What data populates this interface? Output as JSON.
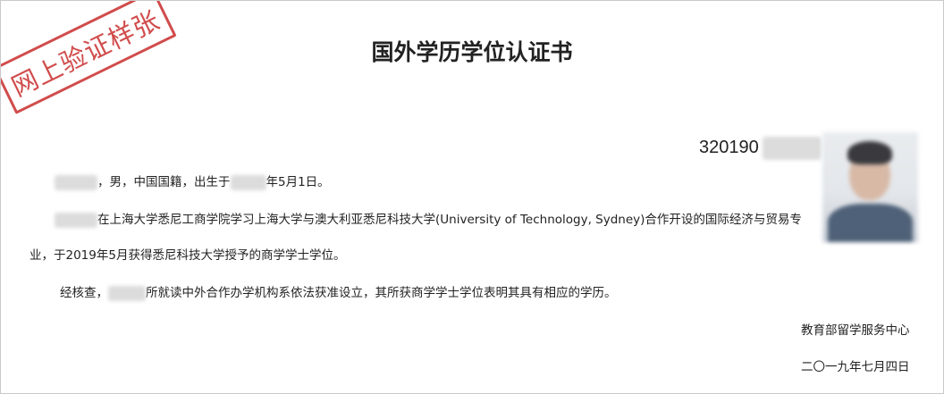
{
  "stamp": {
    "text": "网上验证样张",
    "color": "#d14c4c"
  },
  "title": "国外学历学位认证书",
  "certificate_number": {
    "visible_prefix": "320190"
  },
  "body": {
    "line1": {
      "part1": "，男，中国国籍，出生于",
      "part2": "年5月1日。"
    },
    "line2": {
      "text": "在上海大学悉尼工商学院学习上海大学与澳大利亚悉尼科技大学(University of Technology, Sydney)合作开设的国际经济与贸易专"
    },
    "line3": {
      "text": "业，于2019年5月获得悉尼科技大学授予的商学学士学位。"
    },
    "line4": {
      "part1": "经核查，",
      "part2": "所就读中外合作办学机构系依法获准设立，其所获商学学士学位表明其具有相应的学历。"
    }
  },
  "issuer": "教育部留学服务中心",
  "date": "二〇一九年七月四日"
}
